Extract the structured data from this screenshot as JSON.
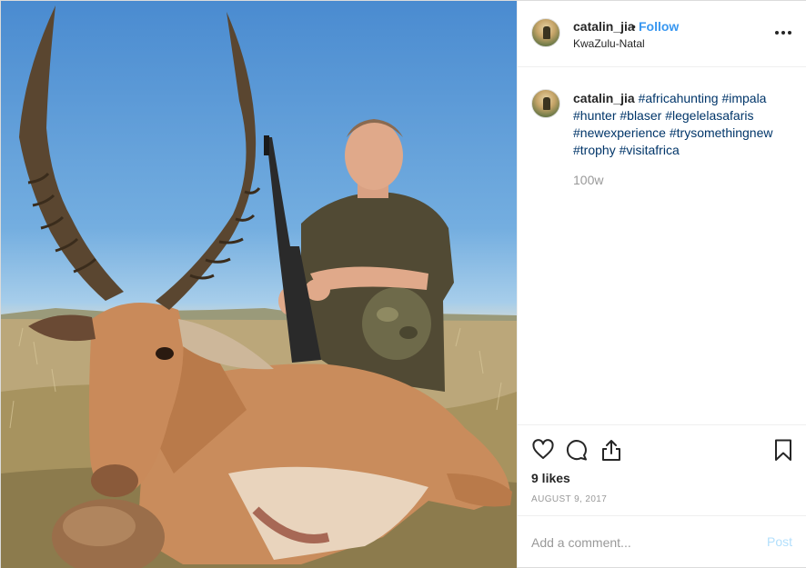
{
  "post": {
    "photo_alt": "",
    "author": {
      "username": "catalin_jia",
      "location": "KwaZulu-Natal",
      "follow_label": "Follow",
      "separator": "•"
    },
    "caption": {
      "username": "catalin_jia",
      "hashtags": [
        "#africahunting",
        "#impala",
        "#hunter",
        "#blaser",
        "#legelelasafaris",
        "#newexperience",
        "#trysomethingnew",
        "#trophy",
        "#visitafrica"
      ],
      "age": "100w"
    },
    "actions": {
      "like_icon": "heart-icon",
      "comment_icon": "comment-icon",
      "share_icon": "share-icon",
      "save_icon": "bookmark-icon"
    },
    "likes": "9 likes",
    "date": "AUGUST 9, 2017",
    "comment_box": {
      "placeholder": "Add a comment...",
      "post_label": "Post"
    },
    "colors": {
      "link_blue": "#3897f0",
      "hashtag": "#003569",
      "muted": "#999999",
      "post_disabled": "#b2dffc"
    }
  }
}
